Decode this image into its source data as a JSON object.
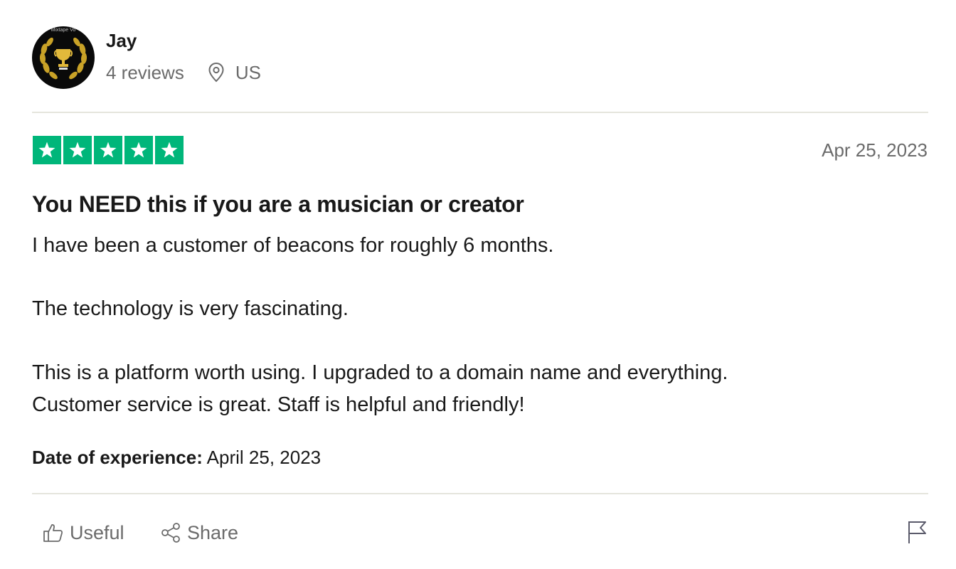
{
  "reviewer": {
    "name": "Jay",
    "reviews_count": "4 reviews",
    "location": "US",
    "avatar_text": "Mixtape Vo"
  },
  "review": {
    "rating": 5,
    "date": "Apr 25, 2023",
    "title": "You NEED this if you are a musician or creator",
    "body_lines": [
      "I have been a customer of beacons for roughly 6 months.",
      "The technology is very fascinating.",
      "This is a platform worth using. I upgraded to a domain name and everything.",
      "Customer service is great. Staff is helpful and friendly!"
    ],
    "experience_label": "Date of experience:",
    "experience_date": "April 25, 2023"
  },
  "actions": {
    "useful_label": "Useful",
    "share_label": "Share"
  },
  "colors": {
    "star_green": "#00b67a",
    "muted_text": "#6b6b6b",
    "divider": "#e5e5dd"
  }
}
